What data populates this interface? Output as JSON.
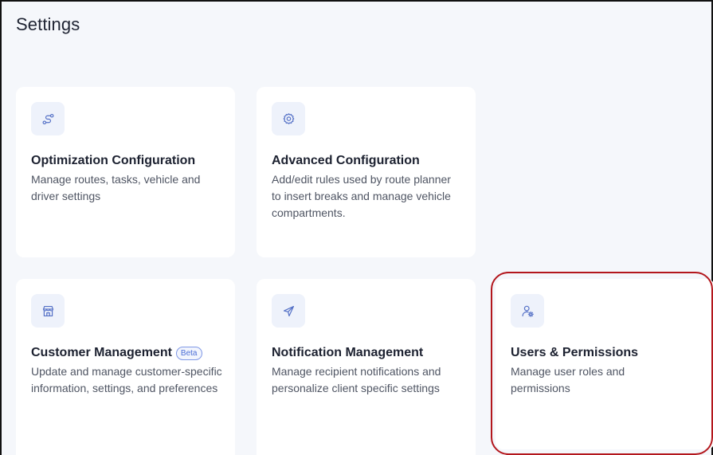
{
  "page": {
    "title": "Settings"
  },
  "cards": {
    "optimization": {
      "icon": "route-icon",
      "title": "Optimization Configuration",
      "description": "Manage routes, tasks, vehicle and driver settings"
    },
    "advanced": {
      "icon": "gear-icon",
      "title": "Advanced Configuration",
      "description": "Add/edit rules used by route planner to insert breaks and manage vehicle compartments."
    },
    "customer": {
      "icon": "store-icon",
      "title": "Customer Management",
      "badge": "Beta",
      "description": "Update and manage customer-specific information, settings, and preferences"
    },
    "notification": {
      "icon": "send-icon",
      "title": "Notification Management",
      "description": "Manage recipient notifications and personalize client specific settings"
    },
    "users": {
      "icon": "user-gear-icon",
      "title": "Users & Permissions",
      "description": "Manage user roles and permissions"
    }
  },
  "colors": {
    "background": "#f5f7fb",
    "card": "#ffffff",
    "icon_tile": "#eef2fb",
    "icon_stroke": "#5470c6",
    "highlight_ring": "#b3171d",
    "beta_badge": "#4c6fd6"
  }
}
